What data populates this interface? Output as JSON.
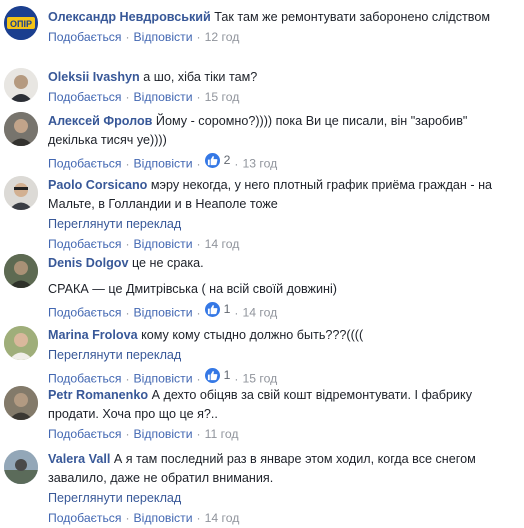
{
  "ui": {
    "like_label": "Подобається",
    "reply_label": "Відповісти",
    "see_translation_label": "Переглянути переклад",
    "dot": "·"
  },
  "colors": {
    "link_blue": "#385898",
    "meta_gray": "#90949c",
    "like_blue": "#3578e5"
  },
  "comments": [
    {
      "author": "Олександр Невдровський",
      "text": " Так там же ремонтувати заборонено слідством",
      "time": "12 год",
      "avatar_icon": "opir-logo-avatar"
    },
    {
      "author": "Oleksii Ivashyn",
      "text": " а шо, хіба тіки там?",
      "time": "15 год",
      "avatar_icon": "user-photo-avatar"
    },
    {
      "author": "Алексей Фролов",
      "text": " Йому - соромно?)))) пока Ви це писали, він \"заробив\" декілька тисяч уе))))",
      "time": "13 год",
      "reactions": "2",
      "avatar_icon": "user-photo-avatar"
    },
    {
      "author": "Paolo Corsicano",
      "text": " мэру некогда, у него плотный график приёма граждан - на Мальте, в Голландии и в Неаполе тоже",
      "time": "14 год",
      "avatar_icon": "user-photo-avatar"
    },
    {
      "author": "Denis Dolgov",
      "text": " це не срака.",
      "text2": "СРАКА — це Дмитрівська ( на всій своїй довжині)",
      "time": "14 год",
      "reactions": "1",
      "avatar_icon": "user-photo-avatar"
    },
    {
      "author": "Marina Frolova",
      "text": " кому кому стыдно должно быть???((((",
      "time": "15 год",
      "reactions": "1",
      "avatar_icon": "user-photo-avatar"
    },
    {
      "author": "Petr Romanenko",
      "text": " А дехто обіцяв за свій кошт відремонтувати. І фабрику продати. Хоча про що це я?..",
      "time": "11 год",
      "avatar_icon": "user-photo-avatar"
    },
    {
      "author": "Valera Vall",
      "text": " А я там последний раз в январе этом ходил, когда все снегом завалило, даже не обратил внимания.",
      "time": "14 год",
      "avatar_icon": "user-photo-avatar"
    }
  ]
}
